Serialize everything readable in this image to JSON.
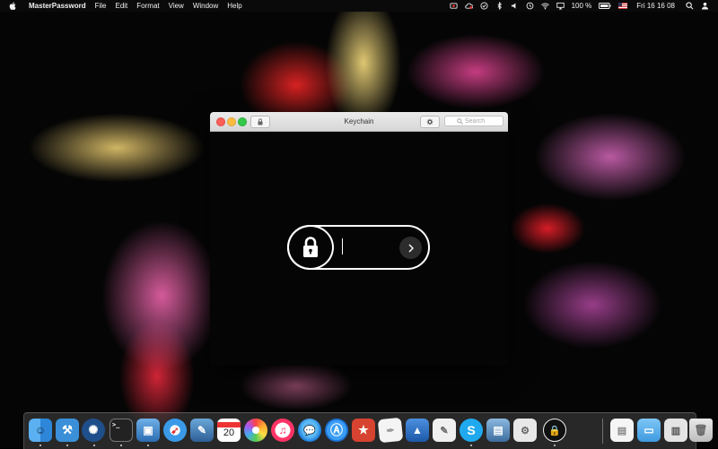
{
  "menubar": {
    "app_name": "MasterPassword",
    "menus": [
      "File",
      "Edit",
      "Format",
      "View",
      "Window",
      "Help"
    ],
    "battery": "100 %",
    "clock": "Fri 16 16 08",
    "status_icons": [
      "creative-cloud-icon",
      "cloud-icon",
      "check-icon",
      "bluetooth-icon",
      "volume-icon",
      "time-machine-icon",
      "wifi-icon",
      "airplay-icon",
      "battery-icon",
      "flag-icon",
      "spotlight-icon",
      "user-icon"
    ]
  },
  "window": {
    "title": "Keychain",
    "search_placeholder": "Search",
    "password_value": ""
  },
  "dock": {
    "apps": [
      {
        "name": "finder",
        "icon": "finder-icon",
        "running": true
      },
      {
        "name": "xcode",
        "icon": "xcode-icon",
        "running": true
      },
      {
        "name": "sourcetree",
        "icon": "sourcetree-icon",
        "running": true
      },
      {
        "name": "terminal",
        "icon": "terminal-icon",
        "running": true
      },
      {
        "name": "preview",
        "icon": "preview-icon",
        "running": true
      },
      {
        "name": "safari",
        "icon": "safari-icon",
        "running": false
      },
      {
        "name": "image-capture",
        "icon": "image-capture-icon",
        "running": false
      },
      {
        "name": "calendar",
        "icon": "calendar-icon",
        "running": false,
        "label": "20"
      },
      {
        "name": "photos",
        "icon": "photos-icon",
        "running": false
      },
      {
        "name": "itunes",
        "icon": "itunes-icon",
        "running": false
      },
      {
        "name": "messages",
        "icon": "messages-icon",
        "running": false
      },
      {
        "name": "app-store",
        "icon": "app-store-icon",
        "running": false
      },
      {
        "name": "wunderlist",
        "icon": "wunderlist-icon",
        "running": false
      },
      {
        "name": "textedit",
        "icon": "textedit-icon",
        "running": false
      },
      {
        "name": "keynote",
        "icon": "keynote-icon",
        "running": false
      },
      {
        "name": "script-editor",
        "icon": "script-editor-icon",
        "running": false
      },
      {
        "name": "skype",
        "icon": "skype-icon",
        "running": true
      },
      {
        "name": "preview-2",
        "icon": "preview-icon",
        "running": false
      },
      {
        "name": "instruments",
        "icon": "instruments-icon",
        "running": false
      },
      {
        "name": "masterpassword",
        "icon": "lock-icon",
        "running": true
      },
      {
        "name": "documents",
        "icon": "document-icon",
        "running": false
      },
      {
        "name": "folder",
        "icon": "folder-icon",
        "running": false
      },
      {
        "name": "archive",
        "icon": "archive-icon",
        "running": false
      },
      {
        "name": "trash",
        "icon": "trash-icon",
        "running": false
      }
    ]
  }
}
